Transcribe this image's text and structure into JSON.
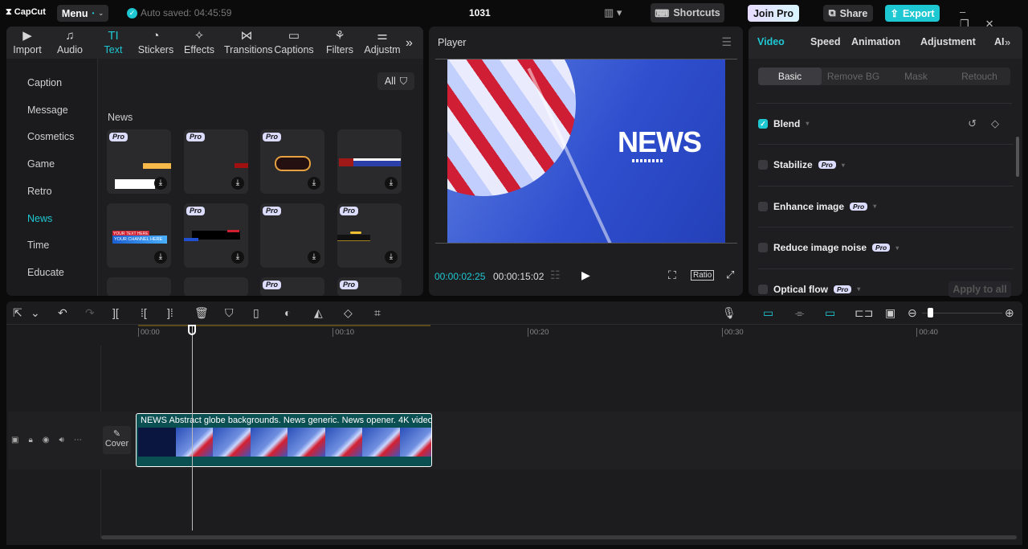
{
  "app": {
    "logo": "CapCut",
    "menu": "Menu",
    "autosave": "Auto saved: 04:45:59",
    "project": "1031",
    "shortcuts": "Shortcuts",
    "join_pro": "Join Pro",
    "share": "Share",
    "export": "Export",
    "accent": "#1ec8d2"
  },
  "media_tabs": [
    {
      "label": "Import",
      "icon": "import-icon"
    },
    {
      "label": "Audio",
      "icon": "audio-icon"
    },
    {
      "label": "Text",
      "icon": "text-icon",
      "active": true
    },
    {
      "label": "Stickers",
      "icon": "stickers-icon"
    },
    {
      "label": "Effects",
      "icon": "effects-icon"
    },
    {
      "label": "Transitions",
      "icon": "transitions-icon"
    },
    {
      "label": "Captions",
      "icon": "captions-icon"
    },
    {
      "label": "Filters",
      "icon": "filters-icon"
    },
    {
      "label": "Adjustm",
      "icon": "adjustment-icon"
    }
  ],
  "categories": [
    {
      "label": "Caption"
    },
    {
      "label": "Message"
    },
    {
      "label": "Cosmetics"
    },
    {
      "label": "Game"
    },
    {
      "label": "Retro"
    },
    {
      "label": "News",
      "active": true
    },
    {
      "label": "Time"
    },
    {
      "label": "Educate"
    }
  ],
  "filter": {
    "label": "All"
  },
  "section": {
    "title": "News"
  },
  "templates": {
    "pro_label": "Pro",
    "thumb_text_1": "YOUR TEXT HERE",
    "thumb_text_2": "YOUR CHANNEL HERE"
  },
  "player": {
    "title": "Player",
    "current_time": "00:00:02:25",
    "total_time": "00:00:15:02",
    "ratio": "Ratio",
    "preview_text": "NEWS"
  },
  "inspector": {
    "tabs": [
      "Video",
      "Speed",
      "Animation",
      "Adjustment",
      "AI"
    ],
    "subtabs": [
      "Basic",
      "Remove BG",
      "Mask",
      "Retouch"
    ],
    "rows": [
      {
        "label": "Blend",
        "checked": true,
        "pro": false
      },
      {
        "label": "Stabilize",
        "checked": false,
        "pro": true
      },
      {
        "label": "Enhance image",
        "checked": false,
        "pro": true
      },
      {
        "label": "Reduce image noise",
        "checked": false,
        "pro": true
      },
      {
        "label": "Optical flow",
        "checked": false,
        "pro": true
      }
    ],
    "pro_label": "Pro",
    "apply_all": "Apply to all"
  },
  "timeline": {
    "ticks": [
      "00:00",
      "00:10",
      "00:20",
      "00:30",
      "00:40"
    ],
    "cover": "Cover",
    "clip_title": "NEWS Abstract globe backgrounds. News generic. News opener. 4K video",
    "playhead_time": "00:00:02:25"
  }
}
